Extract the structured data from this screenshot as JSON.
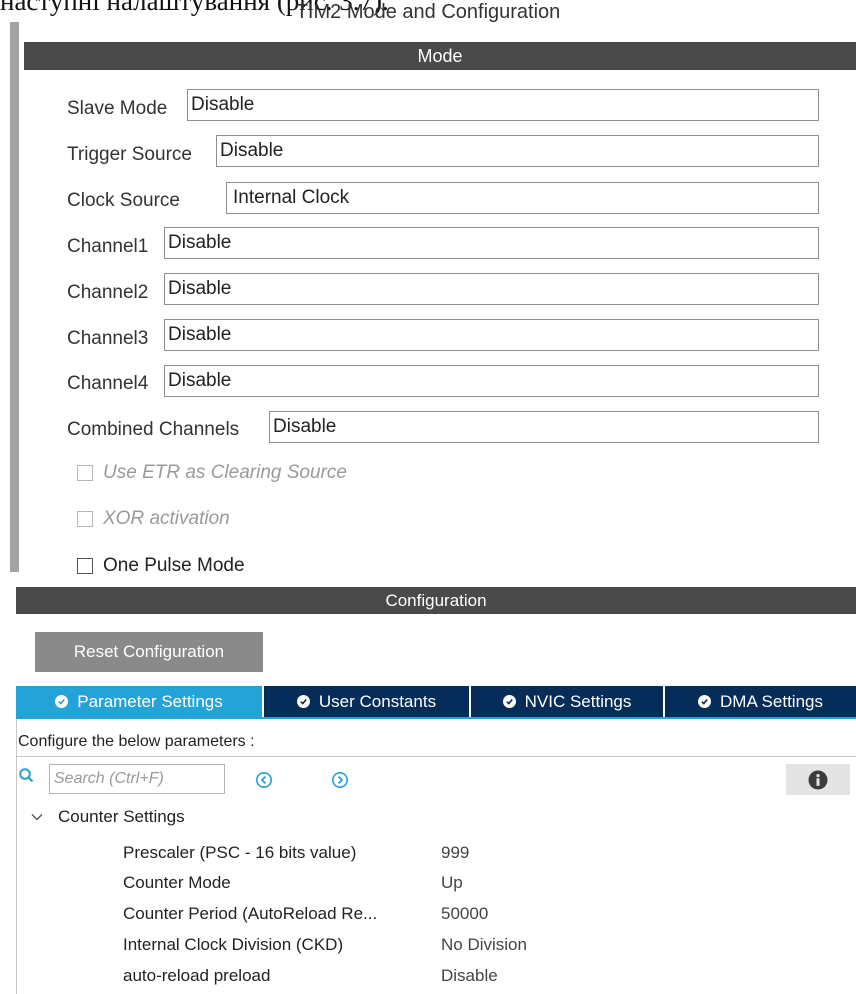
{
  "document": {
    "caption_fragment": "наступні налаштування (рис. 3.7).",
    "panel_title": "TIM2 Mode and Configuration"
  },
  "mode": {
    "header": "Mode",
    "fields": [
      {
        "label": "Slave Mode",
        "value": "Disable"
      },
      {
        "label": "Trigger Source",
        "value": "Disable"
      },
      {
        "label": "Clock Source",
        "value": "Internal Clock"
      },
      {
        "label": "Channel1",
        "value": "Disable"
      },
      {
        "label": "Channel2",
        "value": "Disable"
      },
      {
        "label": "Channel3",
        "value": "Disable"
      },
      {
        "label": "Channel4",
        "value": "Disable"
      },
      {
        "label": "Combined Channels",
        "value": "Disable"
      }
    ],
    "checkboxes": [
      {
        "label": "Use ETR as Clearing Source",
        "checked": false,
        "enabled": false
      },
      {
        "label": "XOR activation",
        "checked": false,
        "enabled": false
      },
      {
        "label": "One Pulse Mode",
        "checked": false,
        "enabled": true
      }
    ]
  },
  "configuration": {
    "header": "Configuration",
    "reset_label": "Reset Configuration",
    "tabs": [
      {
        "label": "Parameter Settings",
        "active": true
      },
      {
        "label": "User Constants",
        "active": false
      },
      {
        "label": "NVIC Settings",
        "active": false
      },
      {
        "label": "DMA Settings",
        "active": false
      }
    ],
    "instruction": "Configure the below parameters :",
    "search_placeholder": "Search (Ctrl+F)",
    "group": {
      "title": "Counter Settings",
      "expanded": true,
      "params": [
        {
          "name": "Prescaler (PSC - 16 bits value)",
          "value": "999"
        },
        {
          "name": "Counter Mode",
          "value": "Up"
        },
        {
          "name": "Counter Period (AutoReload Re...",
          "value": "50000"
        },
        {
          "name": "Internal Clock Division (CKD)",
          "value": "No Division"
        },
        {
          "name": "auto-reload preload",
          "value": "Disable"
        }
      ]
    }
  },
  "colors": {
    "header_bg": "#4a4a4a",
    "tab_active": "#24a3d9",
    "tab_inactive": "#062c5a",
    "nav_icon": "#2a9fd6"
  }
}
